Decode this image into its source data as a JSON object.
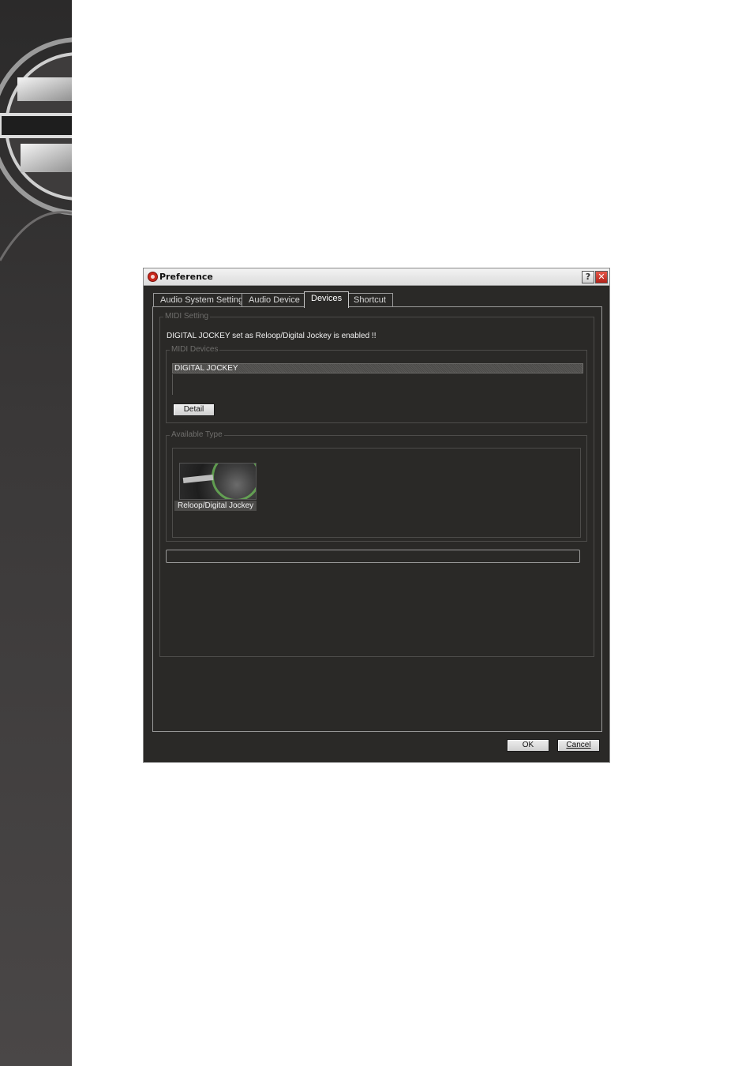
{
  "window": {
    "title": "Preference",
    "help_glyph": "?",
    "close_glyph": "✕"
  },
  "tabs": [
    {
      "label": "Audio System Setting"
    },
    {
      "label": "Audio Device"
    },
    {
      "label": "Devices"
    },
    {
      "label": "Shortcut"
    }
  ],
  "active_tab": "Devices",
  "midi_setting": {
    "legend": "MIDI Setting",
    "message": "DIGITAL JOCKEY set as Reloop/Digital Jockey is enabled !!",
    "devices": {
      "legend": "MIDI Devices",
      "items": [
        "DIGITAL JOCKEY"
      ],
      "detail_button": "Detail"
    },
    "available_type": {
      "legend": "Available Type",
      "items": [
        {
          "label": "Reloop/Digital Jockey"
        }
      ]
    }
  },
  "footer": {
    "ok_button": "OK",
    "cancel_button": "Cancel"
  },
  "colors": {
    "dialog_bg": "#2a2927",
    "close_button": "#c8261b",
    "accent_ring": "#6fbf5a"
  }
}
